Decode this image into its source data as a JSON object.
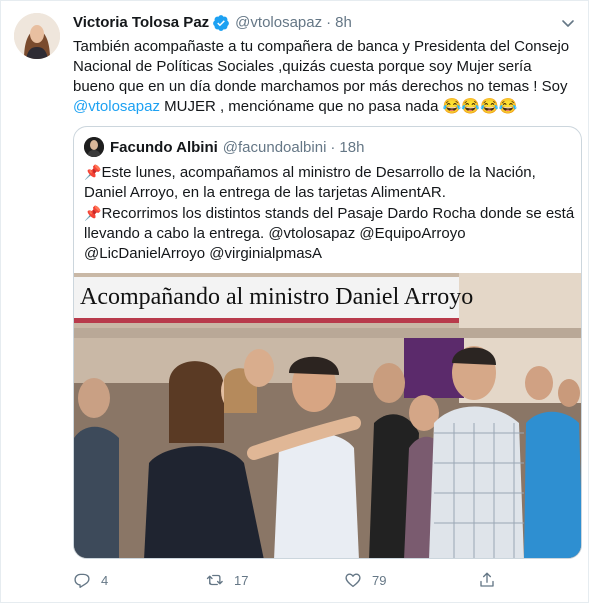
{
  "tweet": {
    "author_name": "Victoria Tolosa Paz",
    "author_handle": "@vtolosapaz",
    "separator": "·",
    "time": "8h",
    "text_part1": "También acompañaste a tu compañera de banca y Presidenta del Consejo Nacional de Políticas Sociales ,quizás cuesta porque soy Mujer sería bueno que en un día donde marchamos por más derechos no temas ! Soy ",
    "text_mention": "@vtolosapaz",
    "text_part2": " MUJER , mencióname que no pasa nada ",
    "text_emoji": "😂😂😂😂"
  },
  "quoted": {
    "author_name": "Facundo Albini",
    "author_handle": "@facundoalbini",
    "separator": "·",
    "time": "18h",
    "pin_emoji": "📌",
    "line1": "Este lunes, acompañamos al ministro de Desarrollo de la Nación,",
    "line2": "Daniel Arroyo, en la entrega de las tarjetas AlimentAR.",
    "line3": "Recorrimos los distintos stands del Pasaje Dardo Rocha donde se está",
    "line4": "llevando a cabo la entrega.",
    "line4_mentions": "@vtolosapaz @EquipoArroyo",
    "line5_mentions": "@LicDanielArroyo @virginialpmasA",
    "image_caption": "Acompañando al ministro Daniel Arroyo"
  },
  "actions": {
    "reply_count": "4",
    "retweet_count": "17",
    "like_count": "79"
  },
  "colors": {
    "accent": "#1da1f2",
    "muted": "#657786",
    "border": "#ccd6dd"
  },
  "icons": [
    "verified-badge-icon",
    "chevron-down-icon",
    "pin-icon",
    "reply-icon",
    "retweet-icon",
    "like-icon",
    "share-icon"
  ]
}
